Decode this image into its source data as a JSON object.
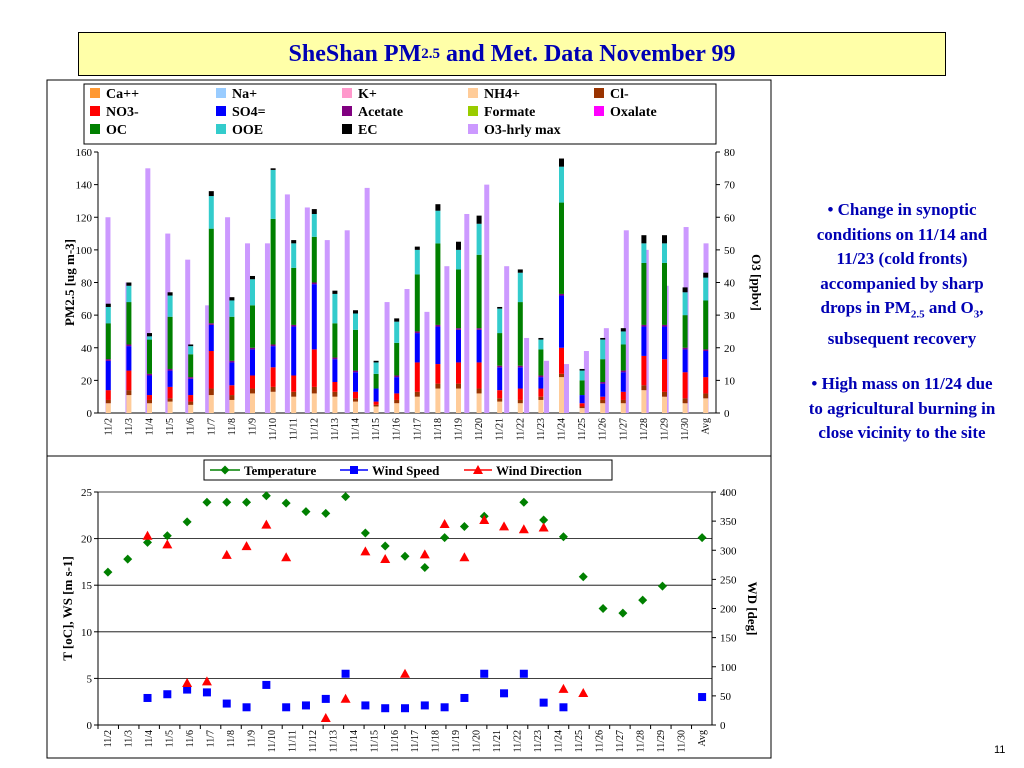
{
  "title": {
    "main": "SheShan PM",
    "sub": "2.5",
    "rest": " and Met. Data November 99"
  },
  "notes": {
    "n1_a": "• Change in synoptic conditions on 11/14 and 11/23 (cold fronts) accompanied by sharp drops in PM",
    "n1_sub1": "2.5",
    "n1_b": " and O",
    "n1_sub2": "3",
    "n1_c": ", subsequent recovery",
    "n2": "• High mass on 11/24 due to agricultural burning in close vicinity to the site"
  },
  "slide_number": "11",
  "chart_data": [
    {
      "type": "bar",
      "stacked": true,
      "categories": [
        "11/2",
        "11/3",
        "11/4",
        "11/5",
        "11/6",
        "11/7",
        "11/8",
        "11/9",
        "11/10",
        "11/11",
        "11/12",
        "11/13",
        "11/14",
        "11/15",
        "11/16",
        "11/17",
        "11/18",
        "11/19",
        "11/20",
        "11/21",
        "11/22",
        "11/23",
        "11/24",
        "11/25",
        "11/26",
        "11/27",
        "11/28",
        "11/29",
        "11/30",
        "Avg"
      ],
      "ylabel": "PM2.5 [ug m-3]",
      "y2label": "O3 [ppbv]",
      "ylim": [
        0,
        160
      ],
      "y2lim": [
        0,
        80
      ],
      "yticks": [
        0,
        20,
        40,
        60,
        80,
        100,
        120,
        140,
        160
      ],
      "y2ticks": [
        0,
        10,
        20,
        30,
        40,
        50,
        60,
        70,
        80
      ],
      "legend": [
        {
          "name": "Ca++",
          "color": "#ff9933"
        },
        {
          "name": "Na+",
          "color": "#99ccff"
        },
        {
          "name": "K+",
          "color": "#ff99cc"
        },
        {
          "name": "NH4+",
          "color": "#ffcc99"
        },
        {
          "name": "Cl-",
          "color": "#993300"
        },
        {
          "name": "NO3-",
          "color": "#ff0000"
        },
        {
          "name": "SO4=",
          "color": "#0000ff"
        },
        {
          "name": "Acetate",
          "color": "#800080"
        },
        {
          "name": "Formate",
          "color": "#99cc00"
        },
        {
          "name": "Oxalate",
          "color": "#ff00ff"
        },
        {
          "name": "OC",
          "color": "#008000"
        },
        {
          "name": "OOE",
          "color": "#33cccc"
        },
        {
          "name": "EC",
          "color": "#000000"
        },
        {
          "name": "O3-hrly max",
          "color": "#cc99ff"
        }
      ],
      "series": [
        {
          "name": "NH4+",
          "values": [
            6,
            11,
            6,
            7,
            5,
            11,
            8,
            12,
            13,
            10,
            12,
            10,
            7,
            4,
            6,
            10,
            15,
            15,
            12,
            7,
            6,
            8,
            22,
            3,
            6,
            6,
            14,
            10,
            6,
            9
          ]
        },
        {
          "name": "Cl-",
          "values": [
            2,
            3,
            2,
            2,
            2,
            4,
            3,
            3,
            3,
            3,
            4,
            3,
            2,
            1,
            2,
            3,
            3,
            3,
            3,
            2,
            2,
            2,
            2,
            1,
            2,
            2,
            3,
            3,
            3,
            3
          ]
        },
        {
          "name": "NO3-",
          "values": [
            6,
            12,
            3,
            7,
            4,
            23,
            6,
            8,
            12,
            10,
            23,
            6,
            4,
            2,
            4,
            18,
            12,
            13,
            16,
            5,
            7,
            5,
            16,
            2,
            2,
            5,
            18,
            20,
            16,
            10
          ]
        },
        {
          "name": "SO4=",
          "values": [
            18,
            15,
            12,
            10,
            10,
            16,
            14,
            16,
            13,
            30,
            40,
            14,
            12,
            8,
            10,
            18,
            23,
            20,
            20,
            14,
            13,
            7,
            32,
            5,
            8,
            12,
            18,
            20,
            14,
            16
          ]
        },
        {
          "name": "Acetate",
          "values": [
            1,
            1,
            1,
            1,
            1,
            1,
            1,
            1,
            1,
            1,
            1,
            1,
            1,
            0,
            1,
            1,
            1,
            1,
            1,
            1,
            1,
            1,
            1,
            0,
            1,
            1,
            1,
            1,
            1,
            1
          ]
        },
        {
          "name": "OC",
          "values": [
            22,
            26,
            21,
            32,
            14,
            58,
            27,
            26,
            77,
            35,
            28,
            21,
            25,
            9,
            20,
            35,
            50,
            36,
            45,
            20,
            39,
            16,
            56,
            9,
            14,
            16,
            38,
            38,
            20,
            30
          ]
        },
        {
          "name": "OOE",
          "values": [
            10,
            10,
            2,
            13,
            5,
            20,
            10,
            16,
            30,
            15,
            14,
            18,
            10,
            7,
            13,
            15,
            20,
            12,
            19,
            15,
            18,
            6,
            22,
            6,
            12,
            8,
            12,
            12,
            14,
            14
          ]
        },
        {
          "name": "EC",
          "values": [
            2,
            2,
            2,
            2,
            1,
            3,
            2,
            2,
            1,
            2,
            3,
            2,
            2,
            1,
            2,
            2,
            4,
            5,
            5,
            1,
            2,
            1,
            5,
            1,
            1,
            2,
            5,
            5,
            3,
            3
          ]
        }
      ],
      "o3_hrly_max": [
        60,
        40,
        75,
        55,
        47,
        33,
        60,
        52,
        52,
        67,
        63,
        53,
        56,
        69,
        34,
        38,
        31,
        45,
        61,
        70,
        45,
        23,
        16,
        15,
        19,
        26,
        56,
        50,
        39,
        57,
        52
      ]
    },
    {
      "type": "scatter",
      "categories": [
        "11/2",
        "11/3",
        "11/4",
        "11/5",
        "11/6",
        "11/7",
        "11/8",
        "11/9",
        "11/10",
        "11/11",
        "11/12",
        "11/13",
        "11/14",
        "11/15",
        "11/16",
        "11/17",
        "11/18",
        "11/19",
        "11/20",
        "11/21",
        "11/22",
        "11/23",
        "11/24",
        "11/25",
        "11/26",
        "11/27",
        "11/28",
        "11/29",
        "11/30",
        "Avg"
      ],
      "ylabel": "T [oC], WS [m s-1]",
      "y2label": "WD [deg]",
      "ylim": [
        0,
        25
      ],
      "y2lim": [
        0,
        400
      ],
      "yticks": [
        0,
        5,
        10,
        15,
        20,
        25
      ],
      "y2ticks": [
        0,
        50,
        100,
        150,
        200,
        250,
        300,
        350,
        400
      ],
      "legend": [
        {
          "name": "Temperature",
          "color": "#008000",
          "marker": "diamond"
        },
        {
          "name": "Wind Speed",
          "color": "#0000ff",
          "marker": "square"
        },
        {
          "name": "Wind Direction",
          "color": "#ff0000",
          "marker": "triangle"
        }
      ],
      "series": [
        {
          "name": "Temperature",
          "values": [
            16.4,
            17.8,
            19.6,
            20.3,
            21.8,
            23.9,
            23.9,
            23.9,
            24.6,
            23.8,
            22.9,
            22.7,
            24.5,
            20.6,
            19.2,
            18.1,
            16.9,
            20.1,
            21.3,
            22.4,
            null,
            23.9,
            22.0,
            20.2,
            15.9,
            12.5,
            12.0,
            13.4,
            14.9,
            null,
            20.1
          ]
        },
        {
          "name": "Wind Speed",
          "values": [
            null,
            null,
            2.9,
            3.3,
            3.8,
            3.5,
            2.3,
            1.9,
            4.3,
            1.9,
            2.1,
            2.8,
            5.5,
            2.1,
            1.8,
            1.8,
            2.1,
            1.9,
            2.9,
            5.5,
            3.4,
            5.5,
            2.4,
            1.9,
            null,
            null,
            null,
            null,
            null,
            null,
            3.0
          ]
        },
        {
          "name": "Wind Direction",
          "values": [
            null,
            null,
            325,
            310,
            72,
            75,
            292,
            307,
            344,
            288,
            null,
            12,
            45,
            298,
            285,
            88,
            293,
            345,
            288,
            352,
            341,
            336,
            339,
            62,
            55,
            null,
            null,
            null,
            null,
            null,
            null
          ]
        }
      ]
    }
  ]
}
